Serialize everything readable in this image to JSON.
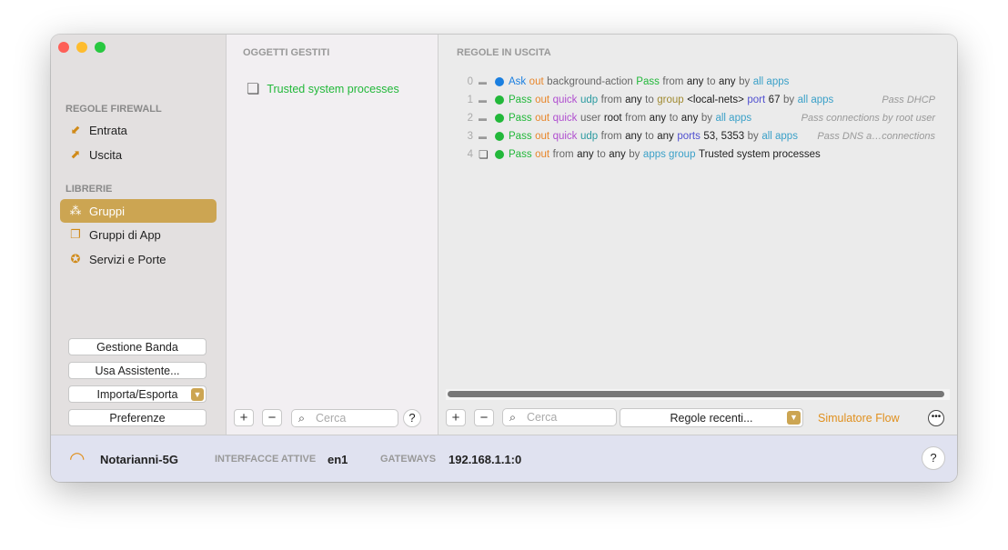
{
  "sidebar": {
    "section_rules": "REGOLE FIREWALL",
    "rules_items": [
      {
        "label": "Entrata",
        "icon": "inbound-icon"
      },
      {
        "label": "Uscita",
        "icon": "outbound-icon"
      }
    ],
    "section_libs": "LIBRERIE",
    "lib_items": [
      {
        "label": "Gruppi",
        "icon": "groups-icon"
      },
      {
        "label": "Gruppi di App",
        "icon": "app-groups-icon"
      },
      {
        "label": "Servizi e Porte",
        "icon": "services-icon"
      }
    ],
    "buttons": [
      "Gestione Banda",
      "Usa Assistente...",
      "Importa/Esporta",
      "Preferenze"
    ]
  },
  "objects": {
    "header": "OGGETTI GESTITI",
    "items": [
      "Trusted system processes"
    ],
    "search_placeholder": "Cerca",
    "help": "?"
  },
  "rules": {
    "header": "REGOLE IN USCITA",
    "rows": [
      {
        "n": "0",
        "status": "ask",
        "tokens": [
          [
            "Ask",
            "ask"
          ],
          [
            "out",
            "out"
          ],
          [
            "background-action",
            "g"
          ],
          [
            "Pass",
            "pass"
          ],
          [
            "from",
            "g"
          ],
          [
            "any",
            "k"
          ],
          [
            "to",
            "g"
          ],
          [
            "any",
            "k"
          ],
          [
            "by",
            "g"
          ],
          [
            "all apps",
            "apps"
          ]
        ],
        "comment": ""
      },
      {
        "n": "1",
        "status": "pass",
        "tokens": [
          [
            "Pass",
            "pass"
          ],
          [
            "out",
            "out"
          ],
          [
            "quick",
            "quick"
          ],
          [
            "udp",
            "udp"
          ],
          [
            "from",
            "g"
          ],
          [
            "any",
            "k"
          ],
          [
            "to",
            "g"
          ],
          [
            "group",
            "grp"
          ],
          [
            "<local-nets>",
            "k"
          ],
          [
            "port",
            "port"
          ],
          [
            "67",
            "k"
          ],
          [
            "by",
            "g"
          ],
          [
            "all apps",
            "apps"
          ]
        ],
        "comment": "Pass DHCP"
      },
      {
        "n": "2",
        "status": "pass",
        "tokens": [
          [
            "Pass",
            "pass"
          ],
          [
            "out",
            "out"
          ],
          [
            "quick",
            "quick"
          ],
          [
            "user",
            "g"
          ],
          [
            "root",
            "k"
          ],
          [
            "from",
            "g"
          ],
          [
            "any",
            "k"
          ],
          [
            "to",
            "g"
          ],
          [
            "any",
            "k"
          ],
          [
            "by",
            "g"
          ],
          [
            "all apps",
            "apps"
          ]
        ],
        "comment": "Pass connections by root user"
      },
      {
        "n": "3",
        "status": "pass",
        "tokens": [
          [
            "Pass",
            "pass"
          ],
          [
            "out",
            "out"
          ],
          [
            "quick",
            "quick"
          ],
          [
            "udp",
            "udp"
          ],
          [
            "from",
            "g"
          ],
          [
            "any",
            "k"
          ],
          [
            "to",
            "g"
          ],
          [
            "any",
            "k"
          ],
          [
            "ports",
            "port"
          ],
          [
            "53, 5353",
            "k"
          ],
          [
            "by",
            "g"
          ],
          [
            "all apps",
            "apps"
          ]
        ],
        "comment": "Pass DNS a…connections"
      },
      {
        "n": "4",
        "status": "pass",
        "tokens": [
          [
            "Pass",
            "pass"
          ],
          [
            "out",
            "out"
          ],
          [
            "from",
            "g"
          ],
          [
            "any",
            "k"
          ],
          [
            "to",
            "g"
          ],
          [
            "any",
            "k"
          ],
          [
            "by",
            "g"
          ],
          [
            "apps group",
            "apps"
          ],
          [
            "Trusted system processes",
            "k"
          ]
        ],
        "comment": ""
      }
    ],
    "search_placeholder": "Cerca",
    "recent": "Regole recenti...",
    "simulator": "Simulatore Flow"
  },
  "status": {
    "network": "Notarianni-5G",
    "iface_label": "INTERFACCE ATTIVE",
    "iface": "en1",
    "gw_label": "GATEWAYS",
    "gw": "192.168.1.1:0",
    "help": "?"
  },
  "colors": {
    "accent": "#cca552",
    "ask": "#1a7fe0",
    "out": "#e8862a",
    "pass": "#22b83a",
    "quick": "#b04fd0",
    "udp": "#2a9aa0",
    "grp": "#a08a30",
    "port": "#5050d0",
    "apps": "#3aa0c8"
  }
}
